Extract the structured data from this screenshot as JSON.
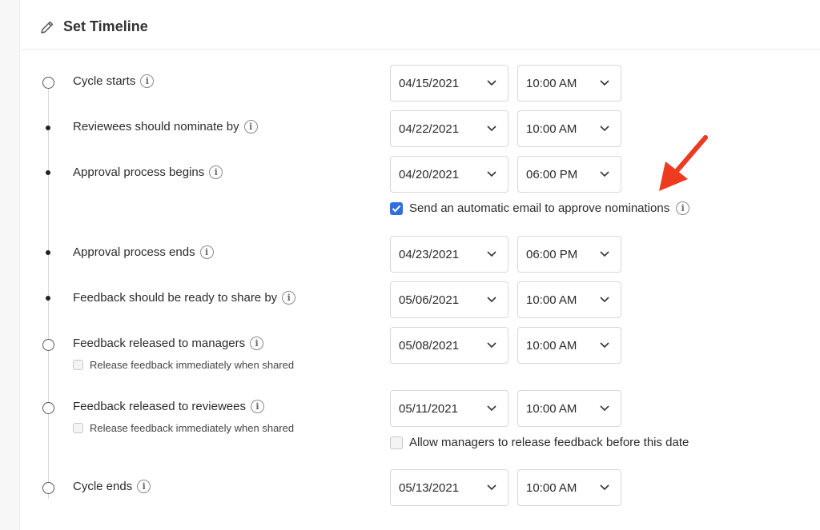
{
  "header": {
    "title": "Set Timeline",
    "icon": "pencil-icon"
  },
  "info_glyph": "i",
  "chevron_icon": "chevron-down-icon",
  "accent_color": "#2f6fde",
  "annotation_color": "#ee3a1f",
  "milestones": [
    {
      "label": "Cycle starts",
      "marker": "hollow",
      "date": "04/15/2021",
      "time": "10:00 AM"
    },
    {
      "label": "Reviewees should nominate by",
      "marker": "dot",
      "date": "04/22/2021",
      "time": "10:00 AM"
    },
    {
      "label": "Approval process begins",
      "marker": "dot",
      "date": "04/20/2021",
      "time": "06:00 PM",
      "option": {
        "label": "Send an automatic email to approve nominations",
        "checked": true
      }
    },
    {
      "label": "Approval process ends",
      "marker": "dot",
      "date": "04/23/2021",
      "time": "06:00 PM"
    },
    {
      "label": "Feedback should be ready to share by",
      "marker": "dot",
      "date": "05/06/2021",
      "time": "10:00 AM"
    },
    {
      "label": "Feedback released to managers",
      "marker": "hollow",
      "date": "05/08/2021",
      "time": "10:00 AM",
      "sub_option": {
        "label": "Release feedback immediately when shared",
        "checked": false
      }
    },
    {
      "label": "Feedback released to reviewees",
      "marker": "hollow",
      "date": "05/11/2021",
      "time": "10:00 AM",
      "sub_option": {
        "label": "Release feedback immediately when shared",
        "checked": false
      },
      "option": {
        "label": "Allow managers to release feedback before this date",
        "checked": false
      }
    },
    {
      "label": "Cycle ends",
      "marker": "hollow",
      "date": "05/13/2021",
      "time": "10:00 AM"
    }
  ]
}
